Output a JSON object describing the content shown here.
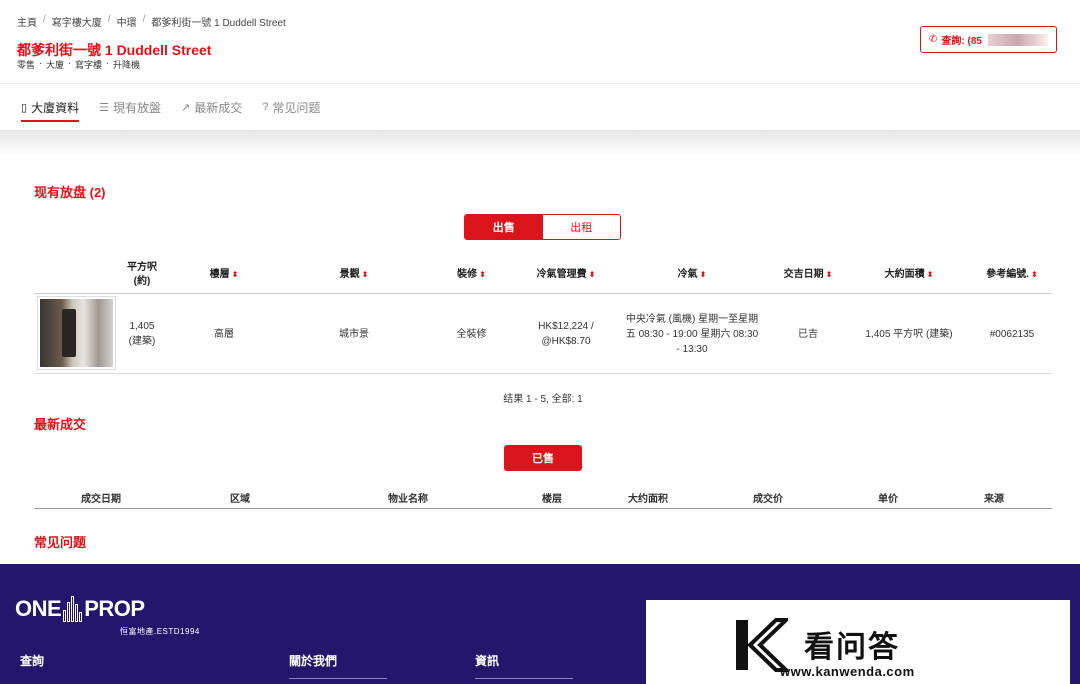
{
  "breadcrumb": [
    "主頁",
    "寫字樓大廈",
    "中環",
    "都爹利街一號 1 Duddell Street"
  ],
  "building": {
    "title": "都爹利街一號 1 Duddell Street",
    "tags": [
      "零售",
      "大廈",
      "寫字樓",
      "升降機"
    ]
  },
  "enquire": {
    "label": "查詢: (85"
  },
  "tabs": [
    {
      "icon": "▯",
      "label": "大廈資料"
    },
    {
      "icon": "☰",
      "label": "現有放盤"
    },
    {
      "icon": "↗",
      "label": "最新成交"
    },
    {
      "icon": "?",
      "label": "常见问题"
    }
  ],
  "listings": {
    "section_title": "现有放盘 (2)",
    "toggle": {
      "sale": "出售",
      "rent": "出租"
    },
    "columns": [
      "平方呎\n(約)",
      "樓層",
      "景觀",
      "裝修",
      "冷氣管理費",
      "冷氣",
      "交吉日期",
      "大約面積",
      "參考編號."
    ],
    "sort_icon": "⬍",
    "rows": [
      {
        "area": "1,405\n(建築)",
        "floor": "高層",
        "view": "城市景",
        "decoration": "全裝修",
        "fee": "HK$12,224 /\n@HK$8.70",
        "ac": "中央冷氣 (風機) 星期一至星期\n五 08:30 - 19:00 星期六 08:30\n- 13:30",
        "vacant": "已吉",
        "approx_area": "1,405 平方呎 (建築)",
        "ref": "#0062135"
      }
    ],
    "results": "结果 1 - 5, 全部: 1"
  },
  "transactions": {
    "section_title": "最新成交",
    "sold_label": "已售",
    "columns": [
      "成交日期",
      "区域",
      "物业名称",
      "楼层",
      "大约面积",
      "成交价",
      "单价",
      "来源"
    ]
  },
  "faq": {
    "section_title": "常见问题"
  },
  "footer": {
    "logo_left": "ONE",
    "logo_right": "PROP",
    "logo_sub": "恒富地產.ESTD1994",
    "links": [
      "查詢",
      "關於我們",
      "資訊"
    ]
  },
  "watermark": {
    "text": "看问答",
    "url": "www.kanwenda.com"
  },
  "colors": {
    "brand_red": "#d9141b",
    "footer_bg": "#24166b"
  }
}
